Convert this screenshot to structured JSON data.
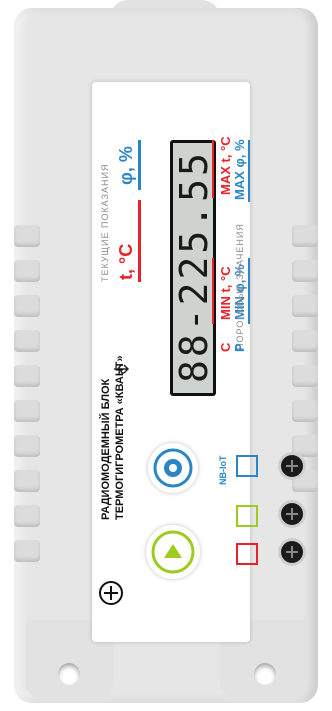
{
  "device": {
    "title_line1": "РАДИОМОДЕМНЫЙ БЛОК",
    "title_line2": "ТЕРМОГИГРОМЕТРА «КВАНТ»",
    "current_readings_label": "ТЕКУЩИЕ ПОКАЗАНИЯ",
    "threshold_label": "ПОРОГОВЫЕ ЗНАЧЕНИЯ",
    "temp_label": "t, °C",
    "humidity_label": "φ, %",
    "min_t_label": "MIN t, °C",
    "min_phi_label": "MIN φ, %",
    "max_t_label": "MAX t, °C",
    "max_phi_label": "MAX φ, %",
    "c_marker": "C",
    "p_marker": "P",
    "lcd_value": "88-225.55",
    "nbiot_label": "NB-IoT",
    "usb_icon": "usb-icon"
  },
  "colors": {
    "red": "#e8212a",
    "blue": "#2a86c9",
    "green": "#9ccc1f",
    "shell": "#e6e6e6"
  }
}
